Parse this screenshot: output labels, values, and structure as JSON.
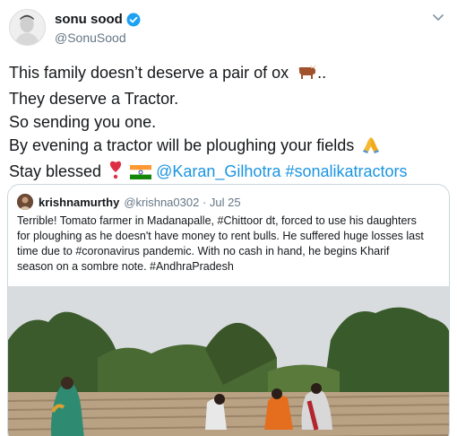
{
  "author": {
    "display_name": "sonu sood",
    "handle": "@SonuSood"
  },
  "tweet": {
    "line1": "This family doesn’t deserve a pair of ox",
    "line1_tail": "..",
    "line2": "They deserve a Tractor.",
    "line3": "So sending you one.",
    "line4": "By evening a tractor will be ploughing your fields",
    "line5_text": "Stay blessed",
    "mention": "@Karan_Gilhotra",
    "hashtag": "#sonalikatractors"
  },
  "quoted_tweet": {
    "display_name": "krishnamurthy",
    "handle_date": "@krishna0302 · Jul 25",
    "lines": [
      "Terrible! Tomato farmer in Madanapalle, #Chittoor dt, forced to use his daughters",
      "for ploughing as he doesn't have money to rent bulls. He suffered huge losses last",
      "time due to #coronavirus pandemic. With no cash in hand, he begins Kharif",
      "season on a sombre note. #AndhraPradesh"
    ]
  },
  "icons": {
    "verified": "verified-badge-icon",
    "menu": "chevron-down-icon",
    "ox": "ox-emoji",
    "pray": "folded-hands-emoji",
    "heart": "heart-exclamation-emoji",
    "flag": "india-flag-emoji"
  },
  "colors": {
    "link": "#1b95e0",
    "verified": "#1da1f2",
    "secondary_text": "#657786"
  }
}
